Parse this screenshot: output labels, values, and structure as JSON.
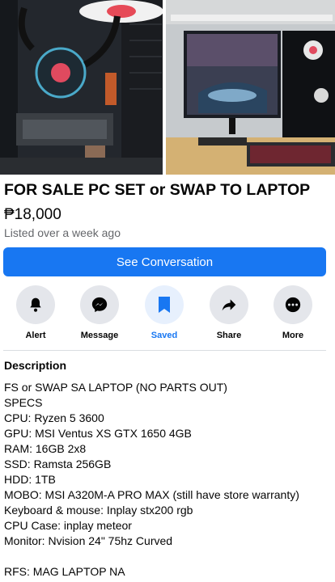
{
  "listing": {
    "title": "FOR SALE PC SET or SWAP TO LAPTOP",
    "price": "₱18,000",
    "listed": "Listed over a week ago"
  },
  "cta": {
    "see_conversation": "See Conversation"
  },
  "actions": [
    {
      "label": "Alert",
      "icon": "bell-icon"
    },
    {
      "label": "Message",
      "icon": "messenger-icon"
    },
    {
      "label": "Saved",
      "icon": "bookmark-icon"
    },
    {
      "label": "Share",
      "icon": "share-arrow-icon"
    },
    {
      "label": "More",
      "icon": "more-dots-icon"
    }
  ],
  "description": {
    "heading": "Description",
    "lines": [
      "FS or SWAP SA LAPTOP (NO PARTS OUT)",
      "SPECS",
      "CPU: Ryzen 5 3600",
      "GPU: MSI Ventus XS GTX 1650 4GB",
      "RAM: 16GB 2x8",
      "SSD: Ramsta 256GB",
      "HDD: 1TB",
      "MOBO: MSI A320M-A PRO MAX (still have store warranty)",
      "Keyboard & mouse: Inplay stx200 rgb",
      "CPU Case: inplay meteor",
      "Monitor: Nvision 24\" 75hz Curved",
      "",
      "RFS: MAG LAPTOP NA"
    ]
  },
  "colors": {
    "accent": "#1877f2",
    "button_bg": "#e4e6eb",
    "muted_text": "#65676b"
  }
}
